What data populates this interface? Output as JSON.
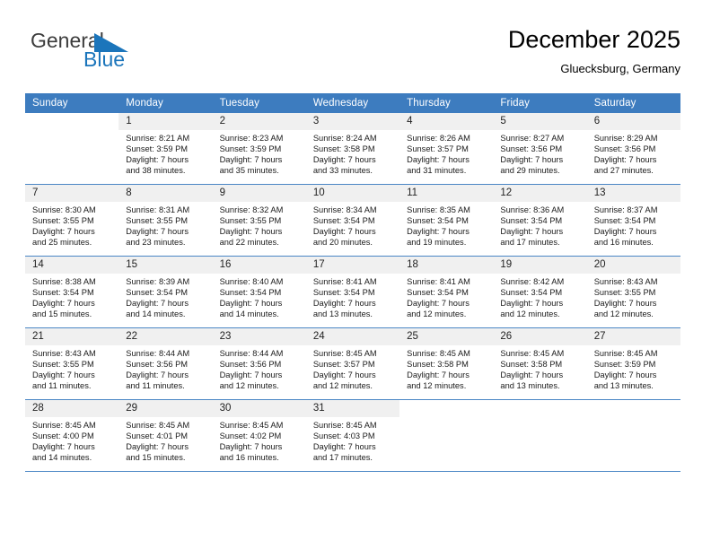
{
  "brand": {
    "name_part1": "General",
    "name_part2": "Blue",
    "logo_icon": "triangle-flag-icon",
    "color_primary": "#1b75bb",
    "color_text": "#3c3c3c"
  },
  "header": {
    "title": "December 2025",
    "subtitle": "Gluecksburg, Germany",
    "header_bg": "#3d7cbf",
    "row_divider": "#4a86c5",
    "daynum_bg": "#f0f0f0"
  },
  "weekday_headers": [
    "Sunday",
    "Monday",
    "Tuesday",
    "Wednesday",
    "Thursday",
    "Friday",
    "Saturday"
  ],
  "weeks": [
    [
      {
        "day": "",
        "empty": true,
        "sunrise": "",
        "sunset": "",
        "daylight1": "",
        "daylight2": ""
      },
      {
        "day": "1",
        "sunrise": "Sunrise: 8:21 AM",
        "sunset": "Sunset: 3:59 PM",
        "daylight1": "Daylight: 7 hours",
        "daylight2": "and 38 minutes."
      },
      {
        "day": "2",
        "sunrise": "Sunrise: 8:23 AM",
        "sunset": "Sunset: 3:59 PM",
        "daylight1": "Daylight: 7 hours",
        "daylight2": "and 35 minutes."
      },
      {
        "day": "3",
        "sunrise": "Sunrise: 8:24 AM",
        "sunset": "Sunset: 3:58 PM",
        "daylight1": "Daylight: 7 hours",
        "daylight2": "and 33 minutes."
      },
      {
        "day": "4",
        "sunrise": "Sunrise: 8:26 AM",
        "sunset": "Sunset: 3:57 PM",
        "daylight1": "Daylight: 7 hours",
        "daylight2": "and 31 minutes."
      },
      {
        "day": "5",
        "sunrise": "Sunrise: 8:27 AM",
        "sunset": "Sunset: 3:56 PM",
        "daylight1": "Daylight: 7 hours",
        "daylight2": "and 29 minutes."
      },
      {
        "day": "6",
        "sunrise": "Sunrise: 8:29 AM",
        "sunset": "Sunset: 3:56 PM",
        "daylight1": "Daylight: 7 hours",
        "daylight2": "and 27 minutes."
      }
    ],
    [
      {
        "day": "7",
        "sunrise": "Sunrise: 8:30 AM",
        "sunset": "Sunset: 3:55 PM",
        "daylight1": "Daylight: 7 hours",
        "daylight2": "and 25 minutes."
      },
      {
        "day": "8",
        "sunrise": "Sunrise: 8:31 AM",
        "sunset": "Sunset: 3:55 PM",
        "daylight1": "Daylight: 7 hours",
        "daylight2": "and 23 minutes."
      },
      {
        "day": "9",
        "sunrise": "Sunrise: 8:32 AM",
        "sunset": "Sunset: 3:55 PM",
        "daylight1": "Daylight: 7 hours",
        "daylight2": "and 22 minutes."
      },
      {
        "day": "10",
        "sunrise": "Sunrise: 8:34 AM",
        "sunset": "Sunset: 3:54 PM",
        "daylight1": "Daylight: 7 hours",
        "daylight2": "and 20 minutes."
      },
      {
        "day": "11",
        "sunrise": "Sunrise: 8:35 AM",
        "sunset": "Sunset: 3:54 PM",
        "daylight1": "Daylight: 7 hours",
        "daylight2": "and 19 minutes."
      },
      {
        "day": "12",
        "sunrise": "Sunrise: 8:36 AM",
        "sunset": "Sunset: 3:54 PM",
        "daylight1": "Daylight: 7 hours",
        "daylight2": "and 17 minutes."
      },
      {
        "day": "13",
        "sunrise": "Sunrise: 8:37 AM",
        "sunset": "Sunset: 3:54 PM",
        "daylight1": "Daylight: 7 hours",
        "daylight2": "and 16 minutes."
      }
    ],
    [
      {
        "day": "14",
        "sunrise": "Sunrise: 8:38 AM",
        "sunset": "Sunset: 3:54 PM",
        "daylight1": "Daylight: 7 hours",
        "daylight2": "and 15 minutes."
      },
      {
        "day": "15",
        "sunrise": "Sunrise: 8:39 AM",
        "sunset": "Sunset: 3:54 PM",
        "daylight1": "Daylight: 7 hours",
        "daylight2": "and 14 minutes."
      },
      {
        "day": "16",
        "sunrise": "Sunrise: 8:40 AM",
        "sunset": "Sunset: 3:54 PM",
        "daylight1": "Daylight: 7 hours",
        "daylight2": "and 14 minutes."
      },
      {
        "day": "17",
        "sunrise": "Sunrise: 8:41 AM",
        "sunset": "Sunset: 3:54 PM",
        "daylight1": "Daylight: 7 hours",
        "daylight2": "and 13 minutes."
      },
      {
        "day": "18",
        "sunrise": "Sunrise: 8:41 AM",
        "sunset": "Sunset: 3:54 PM",
        "daylight1": "Daylight: 7 hours",
        "daylight2": "and 12 minutes."
      },
      {
        "day": "19",
        "sunrise": "Sunrise: 8:42 AM",
        "sunset": "Sunset: 3:54 PM",
        "daylight1": "Daylight: 7 hours",
        "daylight2": "and 12 minutes."
      },
      {
        "day": "20",
        "sunrise": "Sunrise: 8:43 AM",
        "sunset": "Sunset: 3:55 PM",
        "daylight1": "Daylight: 7 hours",
        "daylight2": "and 12 minutes."
      }
    ],
    [
      {
        "day": "21",
        "sunrise": "Sunrise: 8:43 AM",
        "sunset": "Sunset: 3:55 PM",
        "daylight1": "Daylight: 7 hours",
        "daylight2": "and 11 minutes."
      },
      {
        "day": "22",
        "sunrise": "Sunrise: 8:44 AM",
        "sunset": "Sunset: 3:56 PM",
        "daylight1": "Daylight: 7 hours",
        "daylight2": "and 11 minutes."
      },
      {
        "day": "23",
        "sunrise": "Sunrise: 8:44 AM",
        "sunset": "Sunset: 3:56 PM",
        "daylight1": "Daylight: 7 hours",
        "daylight2": "and 12 minutes."
      },
      {
        "day": "24",
        "sunrise": "Sunrise: 8:45 AM",
        "sunset": "Sunset: 3:57 PM",
        "daylight1": "Daylight: 7 hours",
        "daylight2": "and 12 minutes."
      },
      {
        "day": "25",
        "sunrise": "Sunrise: 8:45 AM",
        "sunset": "Sunset: 3:58 PM",
        "daylight1": "Daylight: 7 hours",
        "daylight2": "and 12 minutes."
      },
      {
        "day": "26",
        "sunrise": "Sunrise: 8:45 AM",
        "sunset": "Sunset: 3:58 PM",
        "daylight1": "Daylight: 7 hours",
        "daylight2": "and 13 minutes."
      },
      {
        "day": "27",
        "sunrise": "Sunrise: 8:45 AM",
        "sunset": "Sunset: 3:59 PM",
        "daylight1": "Daylight: 7 hours",
        "daylight2": "and 13 minutes."
      }
    ],
    [
      {
        "day": "28",
        "sunrise": "Sunrise: 8:45 AM",
        "sunset": "Sunset: 4:00 PM",
        "daylight1": "Daylight: 7 hours",
        "daylight2": "and 14 minutes."
      },
      {
        "day": "29",
        "sunrise": "Sunrise: 8:45 AM",
        "sunset": "Sunset: 4:01 PM",
        "daylight1": "Daylight: 7 hours",
        "daylight2": "and 15 minutes."
      },
      {
        "day": "30",
        "sunrise": "Sunrise: 8:45 AM",
        "sunset": "Sunset: 4:02 PM",
        "daylight1": "Daylight: 7 hours",
        "daylight2": "and 16 minutes."
      },
      {
        "day": "31",
        "sunrise": "Sunrise: 8:45 AM",
        "sunset": "Sunset: 4:03 PM",
        "daylight1": "Daylight: 7 hours",
        "daylight2": "and 17 minutes."
      },
      {
        "day": "",
        "empty": true,
        "sunrise": "",
        "sunset": "",
        "daylight1": "",
        "daylight2": ""
      },
      {
        "day": "",
        "empty": true,
        "sunrise": "",
        "sunset": "",
        "daylight1": "",
        "daylight2": ""
      },
      {
        "day": "",
        "empty": true,
        "sunrise": "",
        "sunset": "",
        "daylight1": "",
        "daylight2": ""
      }
    ]
  ]
}
